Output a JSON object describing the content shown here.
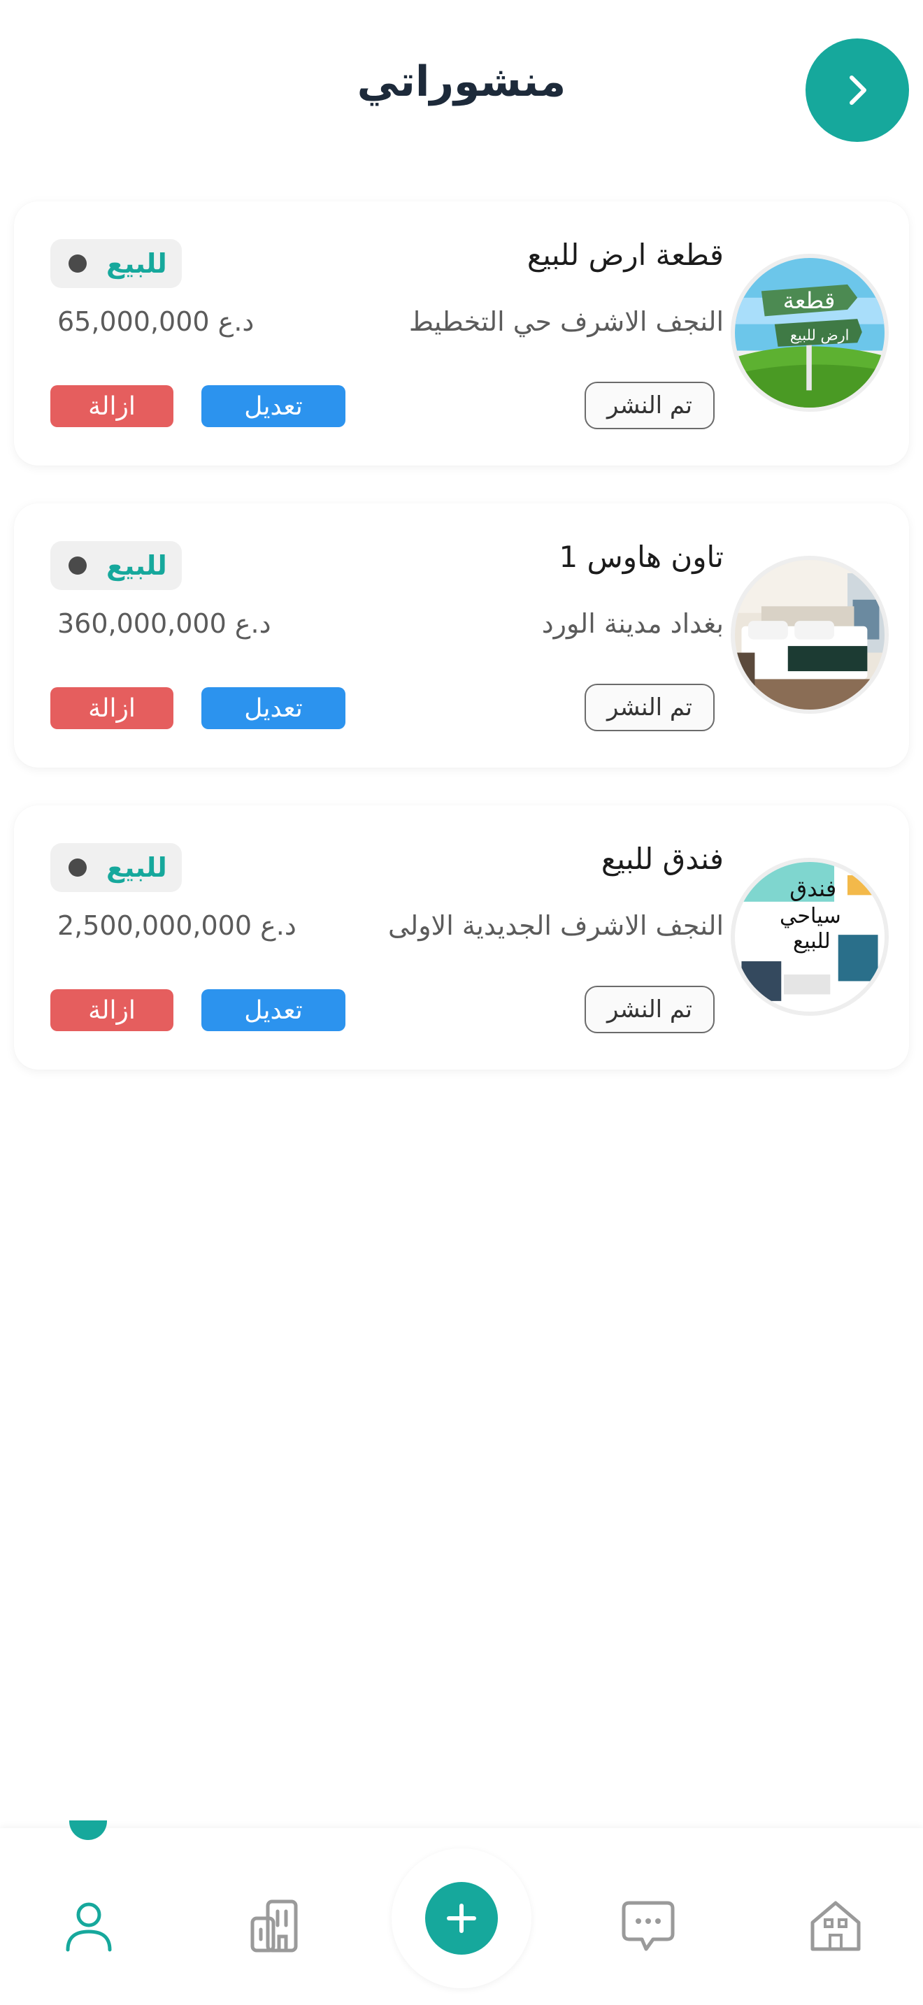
{
  "header": {
    "title": "منشوراتي"
  },
  "listings": [
    {
      "title": "قطعة ارض للبيع",
      "location": "النجف الاشرف حي التخطيط",
      "price": "65,000,000 د.ع",
      "status": "للبيع",
      "published_label": "تم النشر",
      "edit_label": "تعديل",
      "remove_label": "ازالة",
      "image_text_1": "قطعة",
      "image_text_2": "ارض للبيع"
    },
    {
      "title": "تاون هاوس 1",
      "location": "بغداد مدينة الورد",
      "price": "360,000,000 د.ع",
      "status": "للبيع",
      "published_label": "تم النشر",
      "edit_label": "تعديل",
      "remove_label": "ازالة"
    },
    {
      "title": "فندق للبيع",
      "location": "النجف الاشرف الجديدية الاولى",
      "price": "2,500,000,000 د.ع",
      "status": "للبيع",
      "published_label": "تم النشر",
      "edit_label": "تعديل",
      "remove_label": "ازالة",
      "image_text_1": "فندق",
      "image_text_2": "سياحي",
      "image_text_3": "للبيع"
    }
  ],
  "bottom_nav": {
    "items": [
      {
        "icon": "profile-icon",
        "active": true
      },
      {
        "icon": "buildings-icon",
        "active": false
      },
      {
        "icon": "add-icon",
        "active": false
      },
      {
        "icon": "chat-icon",
        "active": false
      },
      {
        "icon": "home-icon",
        "active": false
      }
    ]
  },
  "colors": {
    "accent": "#16a89c",
    "edit": "#2c93ee",
    "remove": "#e55e5e"
  }
}
